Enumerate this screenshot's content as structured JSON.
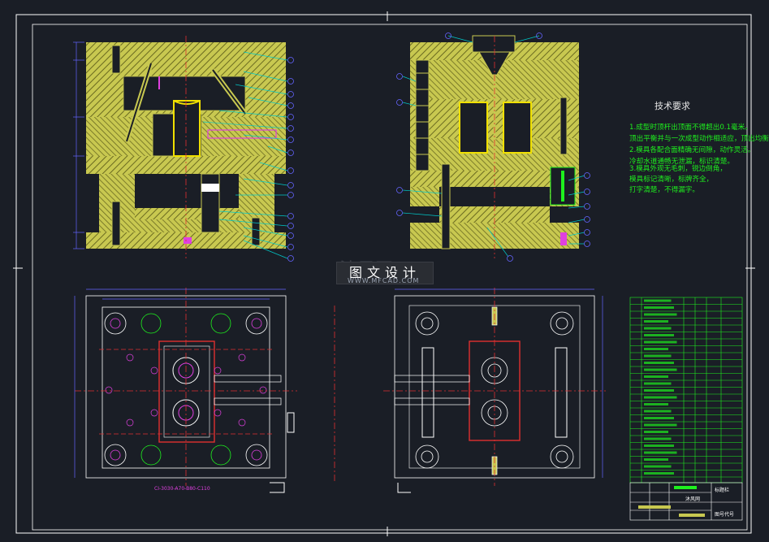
{
  "drawing": {
    "background": "#1a1e26",
    "frame_color": "#ffffff",
    "mold_fill": "#c8c850",
    "hatch_color": "#6a6a20",
    "line_cyan": "#00c8c8",
    "line_red": "#e03030",
    "line_magenta": "#e040e0",
    "line_blue": "#6464ff",
    "green": "#1ef01e",
    "cavity_color": "#f0e000"
  },
  "watermark": {
    "brand": "沐风网",
    "text": "图文设计",
    "url": "WWW.MFCAD.COM"
  },
  "tech": {
    "title": "技术要求",
    "lines": [
      "1.成型时顶杆出顶面不得超出0.1毫米。",
      "顶出平衡并与一次成型动作相适应，顶出均衡灵活。",
      "2.模具各配合面精确无间隙，动作灵活。",
      "冷却水道通畅无泄漏，标识清楚。",
      "3.模具外观无毛刺，锐边倒角，",
      "模具标记清晰，标牌齐全，",
      "打字清楚，不得漏字。"
    ]
  },
  "views": {
    "plan_label": "CI-3030-A70-B80-C110"
  },
  "title_block": {
    "name_cell": "标题栏",
    "drawing_no_cell": "图号代号",
    "company_cell": "沐风网"
  }
}
